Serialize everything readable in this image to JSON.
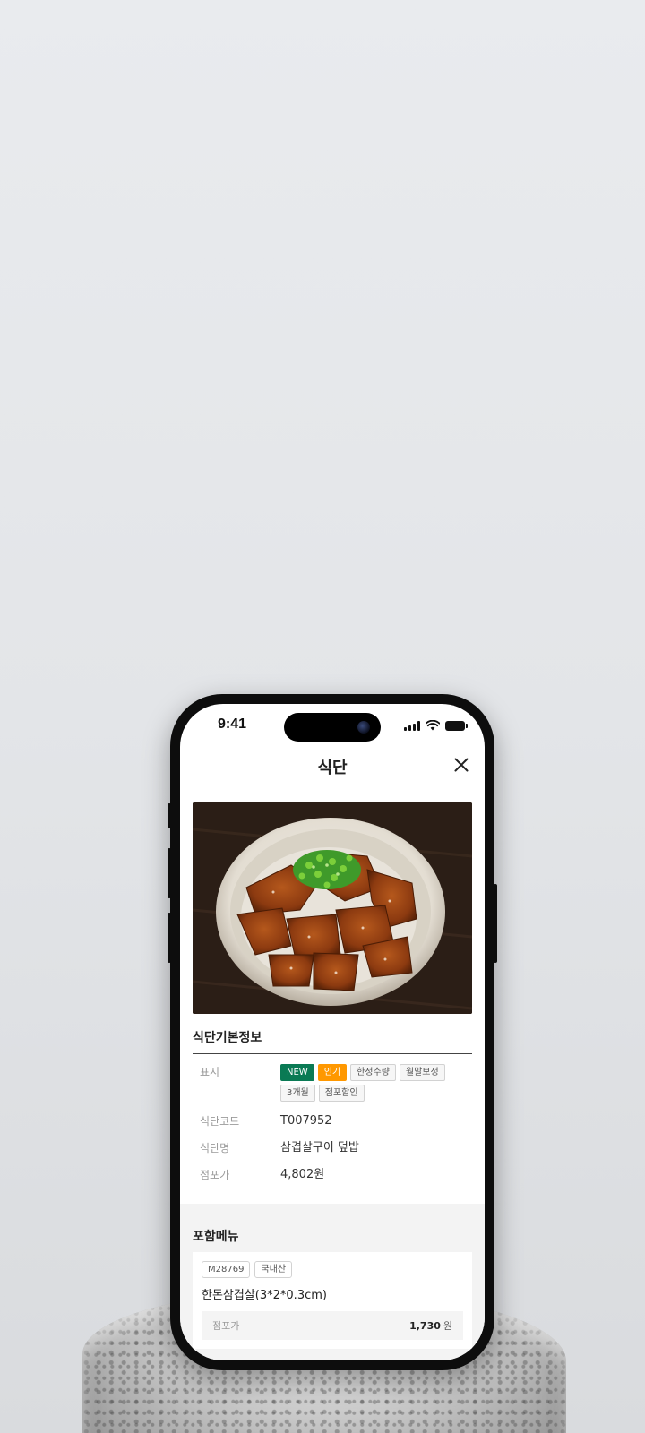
{
  "status_bar": {
    "time": "9:41"
  },
  "header": {
    "title": "식단"
  },
  "basic_info": {
    "section_title": "식단기본정보",
    "display": {
      "label": "표시",
      "badges": [
        "NEW",
        "인기",
        "한정수량",
        "월말보정",
        "3개월",
        "점포할인"
      ]
    },
    "code": {
      "label": "식단코드",
      "value": "T007952"
    },
    "name": {
      "label": "식단명",
      "value": "삼겹살구이 덮밥"
    },
    "price": {
      "label": "점포가",
      "value": "4,802원"
    }
  },
  "included_menu": {
    "section_title": "포함메뉴",
    "items": [
      {
        "code": "M28769",
        "origin": "국내산",
        "name": "한돈삼겹살(3*2*0.3cm)",
        "price_label": "점포가",
        "price": "1,730",
        "unit": "원"
      }
    ]
  },
  "colors": {
    "new_badge": "#0a7a54",
    "popular_badge": "#ff9800"
  }
}
